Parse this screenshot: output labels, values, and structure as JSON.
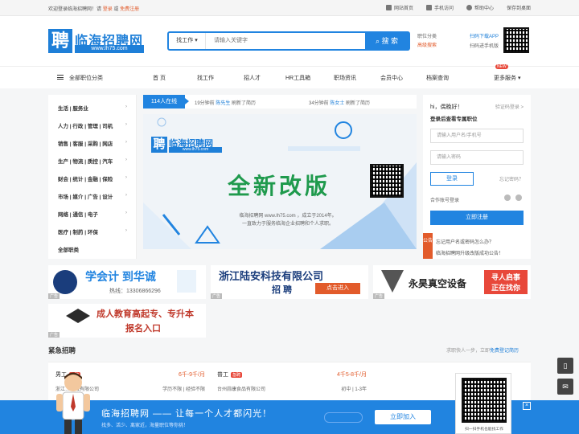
{
  "topbar": {
    "welcome": "欢迎登录临海招聘网！请",
    "login": "登录",
    "or": "或",
    "register": "免费注册",
    "links": [
      {
        "label": "网站首页",
        "icon": "home-icon"
      },
      {
        "label": "手机访问",
        "icon": "mobile-icon"
      },
      {
        "label": "帮助中心",
        "icon": "help-icon"
      },
      {
        "label": "保存到桌面",
        "icon": ""
      }
    ]
  },
  "header": {
    "logo_char": "聘",
    "logo_name": "临海招聘网",
    "logo_url": "www.lh75.com",
    "search": {
      "select": "找工作",
      "placeholder": "请输入关键字",
      "button": "搜 索"
    },
    "links": {
      "category": "职位分类",
      "advanced": "高级搜索"
    },
    "app": {
      "download": "扫码下载APP",
      "mini": "扫码进手机版"
    }
  },
  "nav": {
    "all": "全部职位分类",
    "items": [
      "首 页",
      "找工作",
      "招人才",
      "HR工具箱",
      "职场资讯",
      "会员中心",
      "档案查询"
    ],
    "more": "更多服务",
    "new_badge": "NEW"
  },
  "categories": [
    "生活 | 服务业",
    "人力 | 行政 | 管理 | 司机",
    "销售 | 客服 | 采购 | 网店",
    "生产 | 物流 | 质控 | 汽车",
    "财会 | 统计 | 金融 | 保险",
    "市场 | 媒介 | 广告 | 设计",
    "网络 | 通信 | 电子",
    "医疗 | 制药 | 环保",
    "全部职类"
  ],
  "ticker": {
    "online": "114人在线",
    "items": [
      {
        "time": "19分钟前",
        "name": "陈先生",
        "action": "刷新了简历"
      },
      {
        "time": "34分钟前",
        "name": "陈女士",
        "action": "刷新了简历"
      }
    ]
  },
  "banner": {
    "slogan": "全新改版",
    "desc1": "临海招聘网 www.lh75.com ，成立于2014年。",
    "desc2": "一直致力于服务临海企业招聘和个人求职。"
  },
  "login": {
    "greeting": "hi，偶晚好！",
    "sms_login": "验证码登录 >",
    "subtitle": "登录后查看专属职位",
    "user_placeholder": "请输入用户名/手机号",
    "pwd_placeholder": "请输入密码",
    "login_btn": "登录",
    "forgot": "忘记密码？",
    "other": "合作账号登录",
    "register_btn": "立即注册"
  },
  "notice": {
    "tag": "公告",
    "items": [
      "忘记用户名或密码怎么办？",
      "临海招聘网升级改版成功公告！"
    ]
  },
  "ads": {
    "a1": {
      "t1": "学会计 到华诚",
      "t2": "热线：13306866296"
    },
    "a2": {
      "t1": "浙江陆安科技有限公司",
      "t2": "招 聘",
      "t3": "点击进入"
    },
    "a3": {
      "t1": "永昊真空设备",
      "t2": "寻人启事",
      "t3": "正在找你"
    },
    "a4": {
      "t1": "成人教育高起专、专升本",
      "t2": "报名入口"
    },
    "corner": "广告"
  },
  "section": {
    "title": "紧急招聘",
    "right_prefix": "求职快人一步，立即",
    "right_link": "免费登记简历"
  },
  "jobs": [
    {
      "title": "男工",
      "hot": "急聘",
      "salary": "6千-9千/月",
      "company": "浙江…机械有限公司",
      "cond": "学历不限 | 经验不限"
    },
    {
      "title": "普工",
      "hot": "急聘",
      "salary": "4千5-8千/月",
      "company": "台州蒜康食品有限公司",
      "cond": "初中 | 1-3年"
    }
  ],
  "bottom": {
    "title": "临海招聘网 —— 让每一个人才都闪光！",
    "subtitle": "找多、活少、离家近，海量职位等你挑！",
    "join": "立即加入",
    "qr_caption": "扫一扫手机也能找工作"
  },
  "colors": {
    "brand": "#2184e0",
    "accent": "#e25b2b",
    "hot": "#e8483a"
  }
}
